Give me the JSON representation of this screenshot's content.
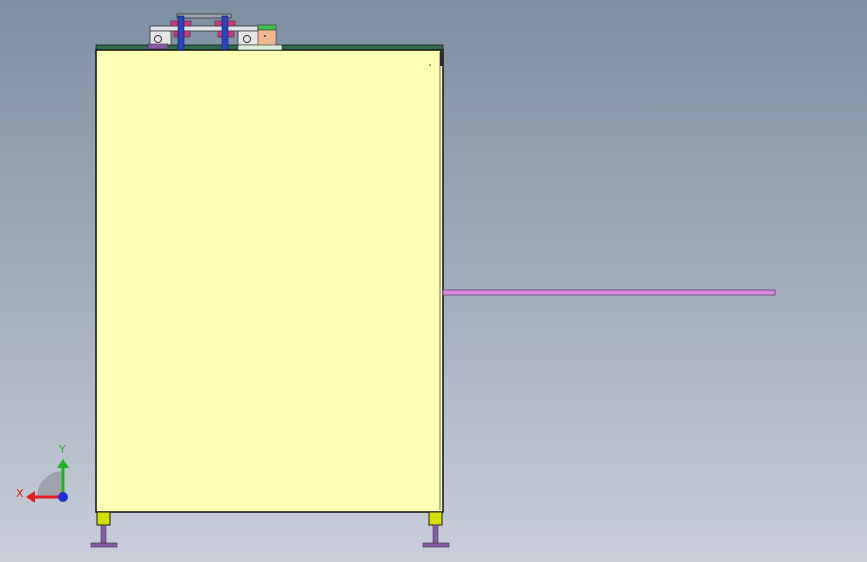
{
  "viewport": {
    "background_top": "#7e8fa2",
    "background_bottom": "#c9ced9"
  },
  "model": {
    "body_color": "#ffffb3",
    "edge_color": "#1a1a1a",
    "top_plate_color": "#2f6b4f",
    "rod_color": "#d98be0",
    "foot_pad_color": "#d6e000",
    "bolt_color": "#8a5aa8",
    "cylinder_color": "#d1357e",
    "shaft_color": "#2a45c4",
    "sensor_green": "#3ec24a",
    "sensor_face": "#f2b890"
  },
  "triad": {
    "x_label": "X",
    "y_label": "Y",
    "x_color": "#e02020",
    "y_color": "#20b020",
    "z_color": "#2030d0"
  }
}
